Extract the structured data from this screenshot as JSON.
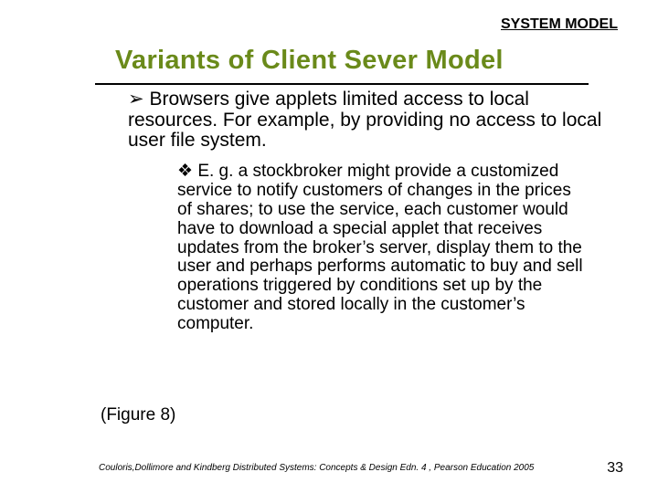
{
  "header": "SYSTEM MODEL",
  "title": "Variants of Client Sever Model",
  "bullet1_glyph": "➢",
  "bullet1": " Browsers give applets limited access to local resources. For example, by providing no access to local user file system.",
  "bullet2_glyph": "❖",
  "bullet2": " E. g. a stockbroker might provide a customized service to notify customers of changes in the prices of shares; to use the service, each customer would have to download a special applet that receives updates from the broker’s server, display them to the user and perhaps performs automatic to buy and sell operations triggered by conditions set up by the customer and stored locally in the customer’s computer.",
  "figure_ref": "(Figure 8)",
  "footer": "Couloris,Dollimore and Kindberg  Distributed Systems: Concepts & Design  Edn. 4 , Pearson Education 2005",
  "page_number": "33"
}
